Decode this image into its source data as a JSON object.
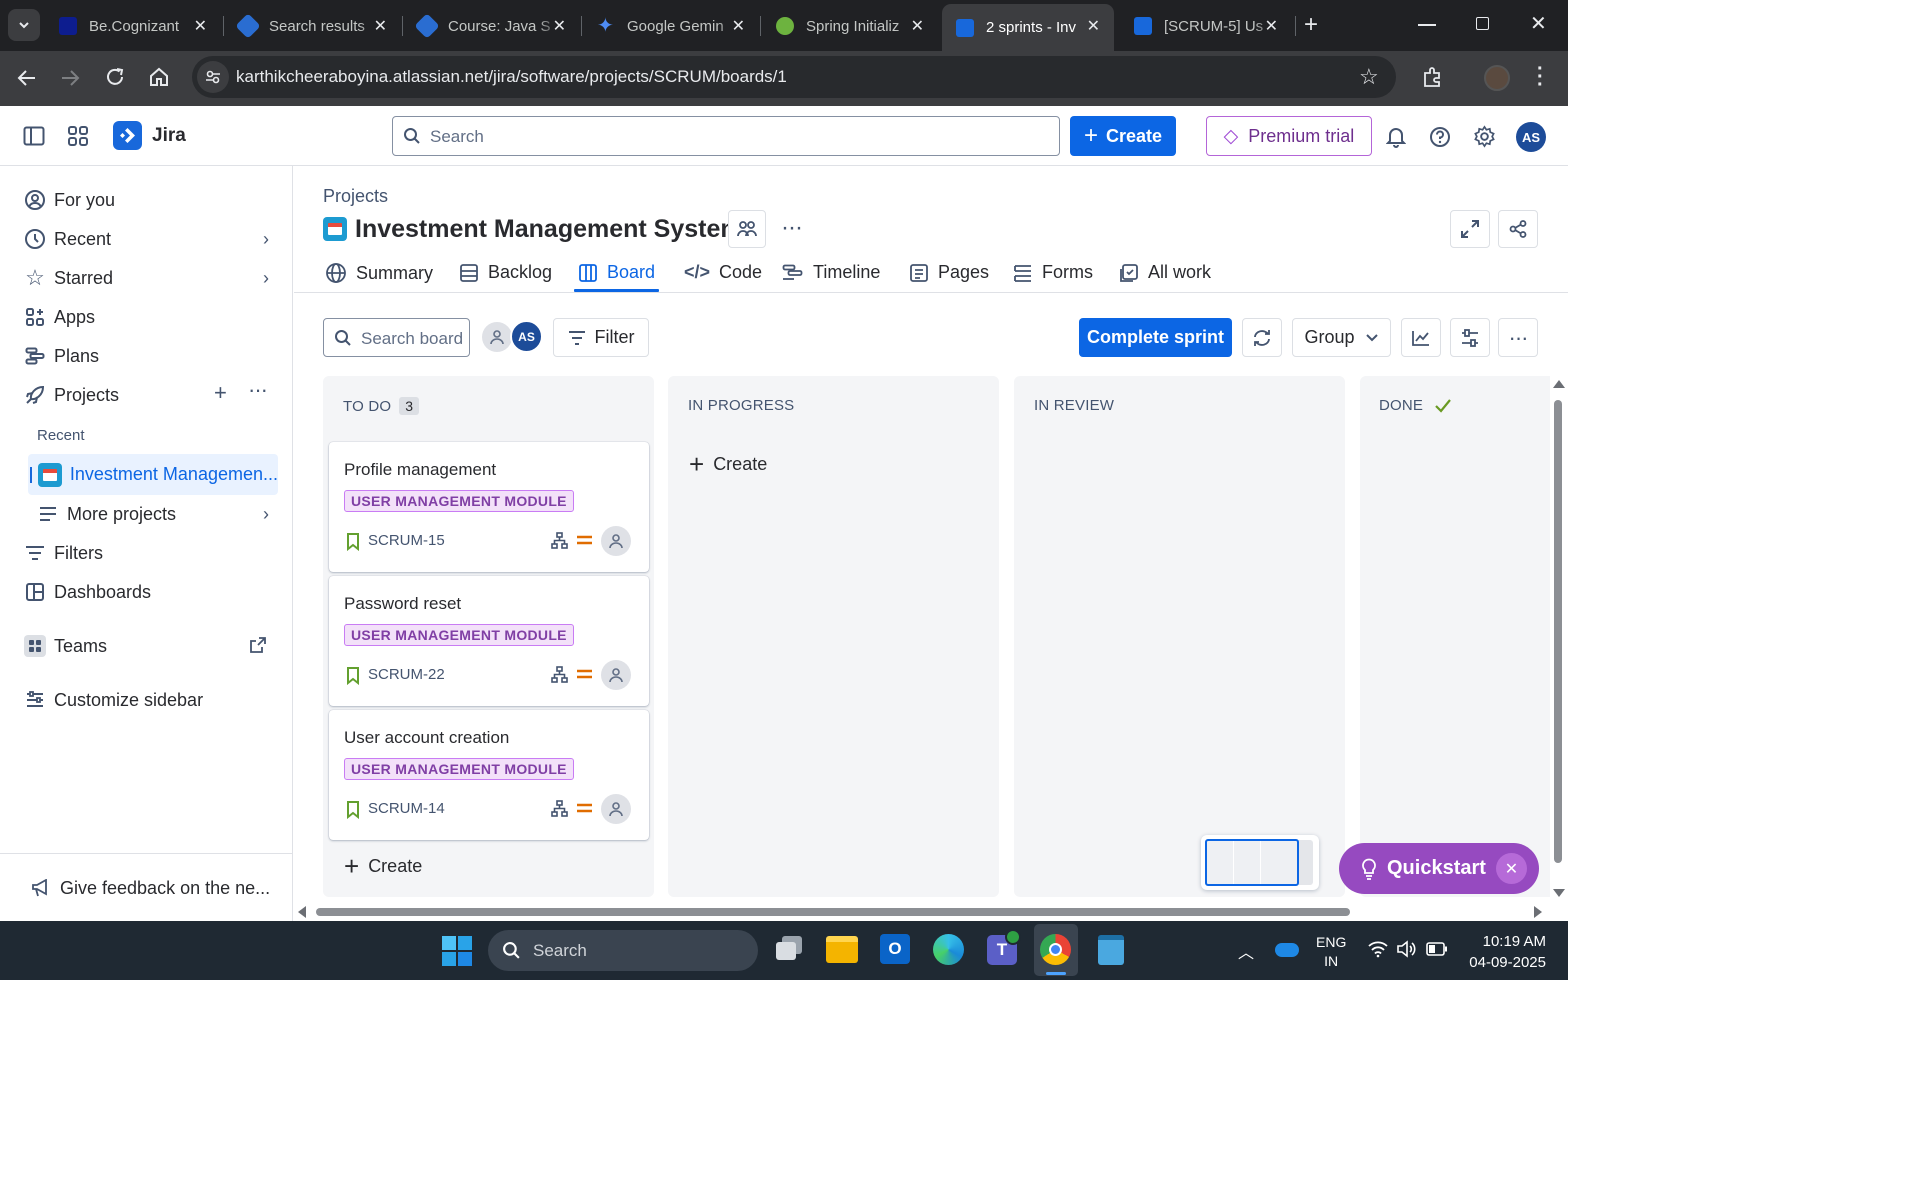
{
  "browser": {
    "tabs": [
      {
        "title": "Be.Cognizant",
        "favicon_color": "#0d1d8f"
      },
      {
        "title": "Search results",
        "favicon_color": "#2a6dd1"
      },
      {
        "title": "Course: Java S",
        "favicon_color": "#2a6dd1"
      },
      {
        "title": "Google Gemin",
        "favicon_color": "#4e8cf5"
      },
      {
        "title": "Spring Initializ",
        "favicon_color": "#6db33f"
      },
      {
        "title": "2 sprints - Inv",
        "favicon_color": "#1868db"
      },
      {
        "title": "[SCRUM-5] Us",
        "favicon_color": "#1868db"
      }
    ],
    "url": "karthikcheeraboyina.atlassian.net/jira/software/projects/SCRUM/boards/1"
  },
  "header": {
    "product": "Jira",
    "search_placeholder": "Search",
    "create_label": "Create",
    "premium_label": "Premium trial",
    "avatar_initials": "AS"
  },
  "sidebar": {
    "items": [
      {
        "label": "For you"
      },
      {
        "label": "Recent"
      },
      {
        "label": "Starred"
      },
      {
        "label": "Apps"
      },
      {
        "label": "Plans"
      },
      {
        "label": "Projects"
      }
    ],
    "recent_heading": "Recent",
    "current_project": "Investment Managemen...",
    "more_projects": "More projects",
    "filters": "Filters",
    "dashboards": "Dashboards",
    "teams": "Teams",
    "customize": "Customize sidebar",
    "feedback": "Give feedback on the ne..."
  },
  "project": {
    "breadcrumb": "Projects",
    "name": "Investment Management System",
    "tabs": [
      {
        "label": "Summary"
      },
      {
        "label": "Backlog"
      },
      {
        "label": "Board"
      },
      {
        "label": "Code"
      },
      {
        "label": "Timeline"
      },
      {
        "label": "Pages"
      },
      {
        "label": "Forms"
      },
      {
        "label": "All work"
      }
    ],
    "active_tab": "Board"
  },
  "toolbar": {
    "search_placeholder": "Search board",
    "avatar_initials": "AS",
    "filter_label": "Filter",
    "complete_sprint_label": "Complete sprint",
    "group_label": "Group"
  },
  "board": {
    "columns": [
      {
        "name": "TO DO",
        "count": "3"
      },
      {
        "name": "IN PROGRESS"
      },
      {
        "name": "IN REVIEW"
      },
      {
        "name": "DONE"
      }
    ],
    "cards": [
      {
        "title": "Profile management",
        "label": "USER MANAGEMENT MODULE",
        "key": "SCRUM-15"
      },
      {
        "title": "Password reset",
        "label": "USER MANAGEMENT MODULE",
        "key": "SCRUM-22"
      },
      {
        "title": "User account creation",
        "label": "USER MANAGEMENT MODULE",
        "key": "SCRUM-14"
      }
    ],
    "create_label": "Create",
    "inprogress_create_label": "Create"
  },
  "quickstart": {
    "label": "Quickstart"
  },
  "taskbar": {
    "search_placeholder": "Search",
    "lang_top": "ENG",
    "lang_bottom": "IN",
    "time": "10:19 AM",
    "date": "04-09-2025"
  }
}
